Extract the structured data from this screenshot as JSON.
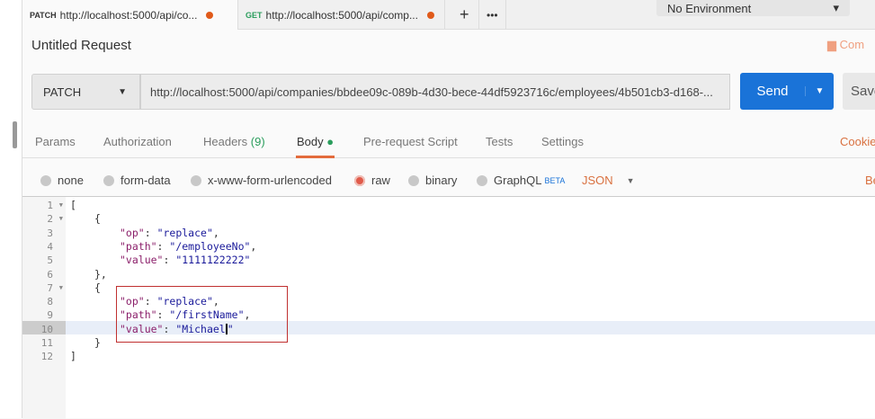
{
  "tabs": [
    {
      "method": "PATCH",
      "url": "http://localhost:5000/api/co..."
    },
    {
      "method": "GET",
      "url": "http://localhost:5000/api/comp..."
    }
  ],
  "tab_add": "+",
  "tab_more": "•••",
  "environment": "No Environment",
  "request_title": "Untitled Request",
  "comments_label": "Com",
  "method": "PATCH",
  "url": "http://localhost:5000/api/companies/bbdee09c-089b-4d30-bece-44df5923716c/employees/4b501cb3-d168-...",
  "send_label": "Send",
  "save_label": "Save",
  "req_tabs": {
    "params": "Params",
    "authorization": "Authorization",
    "headers": "Headers",
    "headers_count": "(9)",
    "body": "Body",
    "pre_request": "Pre-request Script",
    "tests": "Tests",
    "settings": "Settings",
    "cookies": "Cookies"
  },
  "body_options": {
    "none": "none",
    "form_data": "form-data",
    "urlencoded": "x-www-form-urlencoded",
    "raw": "raw",
    "binary": "binary",
    "graphql": "GraphQL",
    "beta": "BETA",
    "format": "JSON",
    "beautify": "Be"
  },
  "code": {
    "l1": "[",
    "l2": "{",
    "k_op": "\"op\"",
    "v_replace": "\"replace\"",
    "k_path": "\"path\"",
    "v_path1": "\"/employeeNo\"",
    "k_value": "\"value\"",
    "v_value1": "\"1111122222\"",
    "l6": "},",
    "l7": "{",
    "v_path2": "\"/firstName\"",
    "v_value2a": "\"Michael",
    "v_value2b": "\"",
    "l11": "}",
    "l12": "]"
  },
  "line_numbers": [
    "1",
    "2",
    "3",
    "4",
    "5",
    "6",
    "7",
    "8",
    "9",
    "10",
    "11",
    "12"
  ]
}
